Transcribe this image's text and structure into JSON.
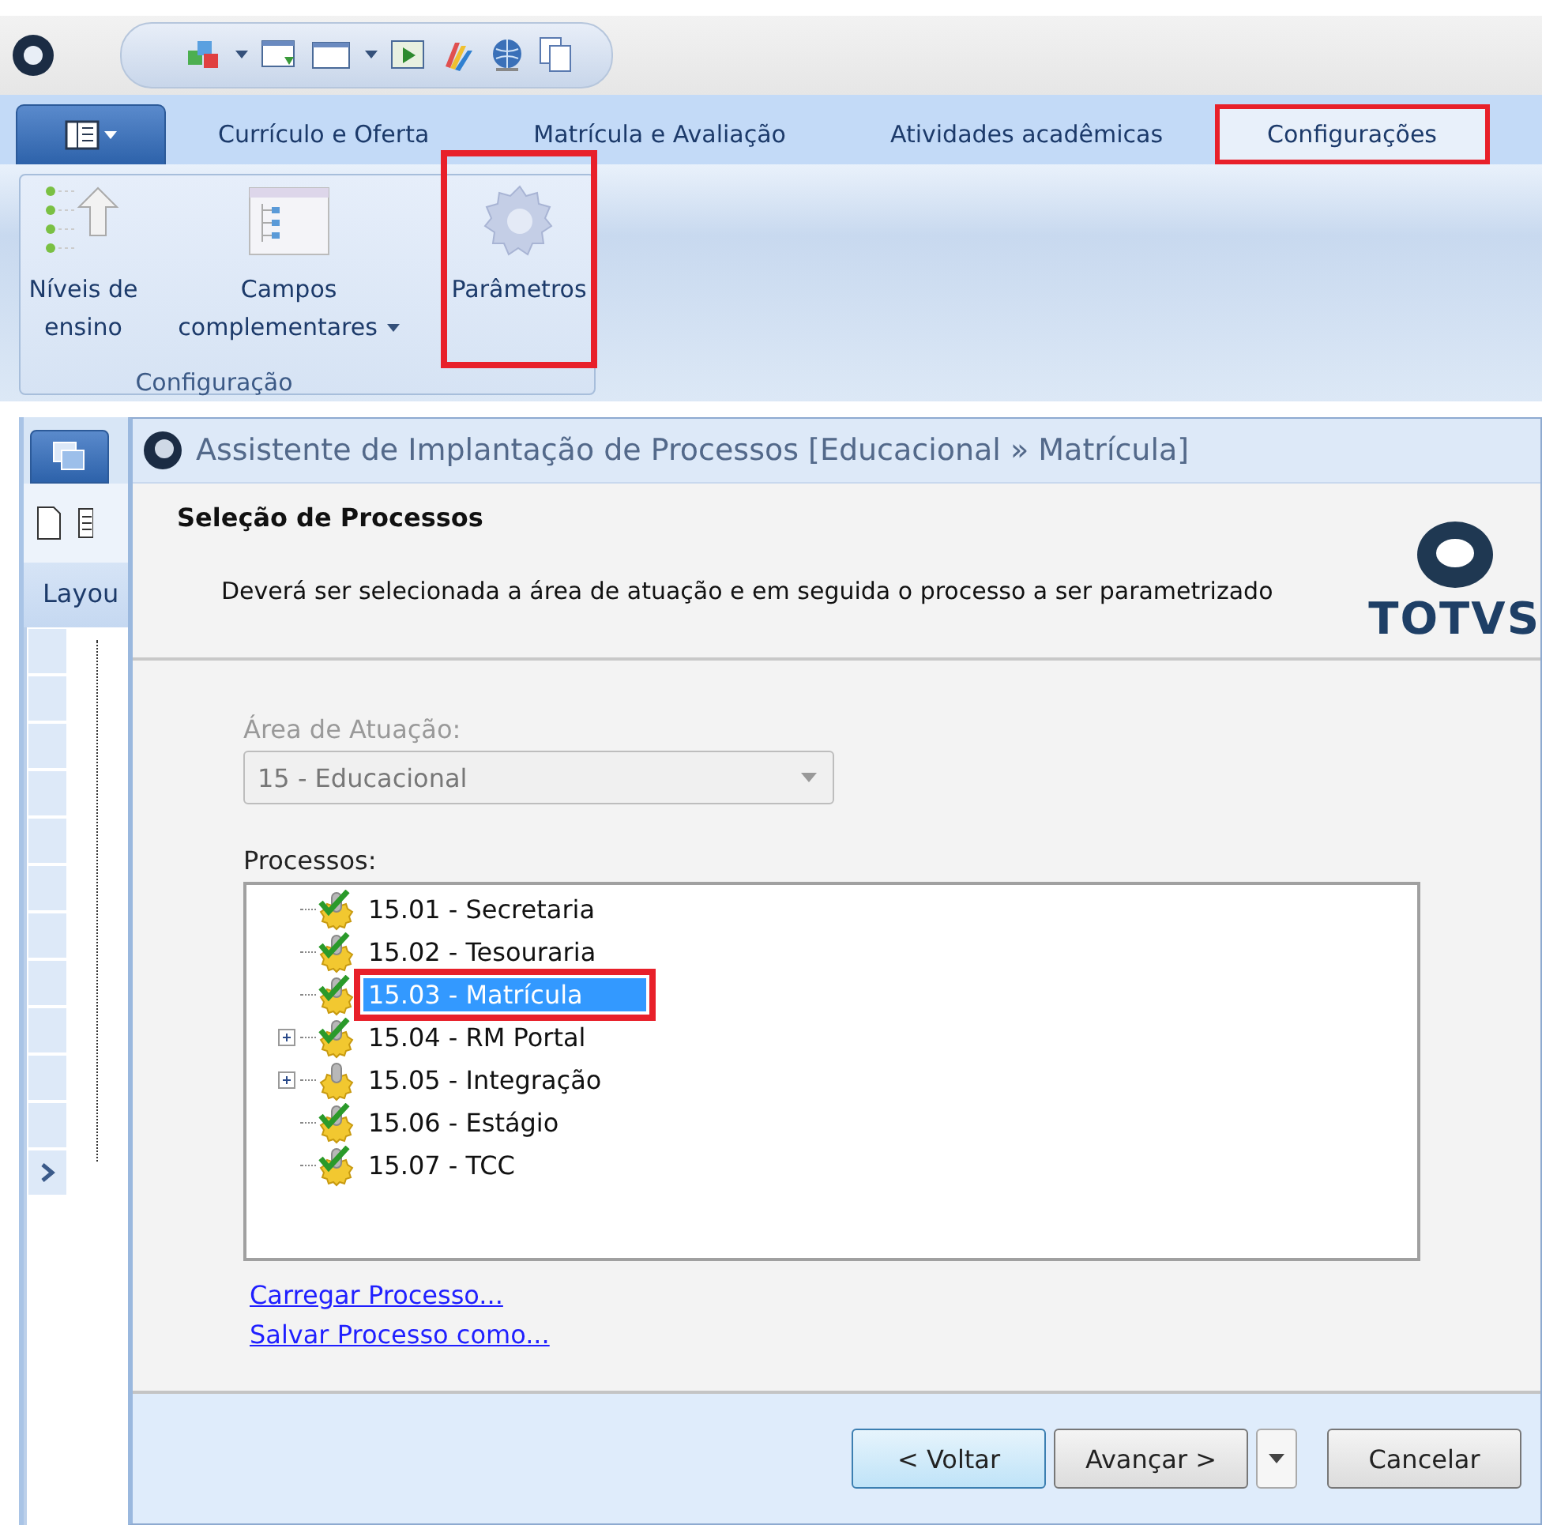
{
  "ribbon": {
    "tabs": [
      {
        "label": "Currículo e Oferta",
        "selected": false,
        "highlighted": false
      },
      {
        "label": "Matrícula e Avaliação",
        "selected": false,
        "highlighted": false
      },
      {
        "label": "Atividades acadêmicas",
        "selected": false,
        "highlighted": false
      },
      {
        "label": "Configurações",
        "selected": true,
        "highlighted": true
      }
    ],
    "group": {
      "label": "Configuração",
      "buttons": [
        {
          "kind": "levels",
          "label": "Níveis de ensino",
          "has_menu": false,
          "highlighted": false
        },
        {
          "kind": "fields",
          "label": "Campos complementares",
          "has_menu": true,
          "highlighted": false
        },
        {
          "kind": "gear",
          "label": "Parâmetros",
          "has_menu": false,
          "highlighted": true
        }
      ]
    }
  },
  "side_panel": {
    "tab_label": "Layou"
  },
  "dialog": {
    "title": "Assistente de Implantação de Processos [Educacional » Matrícula]",
    "heading": "Seleção de Processos",
    "description": "Deverá ser selecionada a área de atuação e em seguida o processo a ser parametrizado",
    "logo": "TOTVS",
    "area": {
      "label": "Área de Atuação:",
      "value": "15 - Educacional",
      "disabled": true
    },
    "processes": {
      "label": "Processos:",
      "items": [
        {
          "label": "15.01 - Secretaria",
          "checked": true,
          "expandable": false,
          "selected": false,
          "highlighted": false
        },
        {
          "label": "15.02 - Tesouraria",
          "checked": true,
          "expandable": false,
          "selected": false,
          "highlighted": false
        },
        {
          "label": "15.03 - Matrícula",
          "checked": true,
          "expandable": false,
          "selected": true,
          "highlighted": true
        },
        {
          "label": "15.04 - RM Portal",
          "checked": true,
          "expandable": true,
          "selected": false,
          "highlighted": false
        },
        {
          "label": "15.05 - Integração",
          "checked": false,
          "expandable": true,
          "selected": false,
          "highlighted": false
        },
        {
          "label": "15.06 - Estágio",
          "checked": true,
          "expandable": false,
          "selected": false,
          "highlighted": false
        },
        {
          "label": "15.07 - TCC",
          "checked": true,
          "expandable": false,
          "selected": false,
          "highlighted": false
        }
      ]
    },
    "links": [
      "Carregar Processo...",
      "Salvar Processo como..."
    ],
    "buttons": [
      {
        "label": "< Voltar",
        "kind": "default"
      },
      {
        "label": "Avançar >",
        "kind": "split"
      },
      {
        "label": "Cancelar",
        "kind": "normal"
      }
    ]
  }
}
